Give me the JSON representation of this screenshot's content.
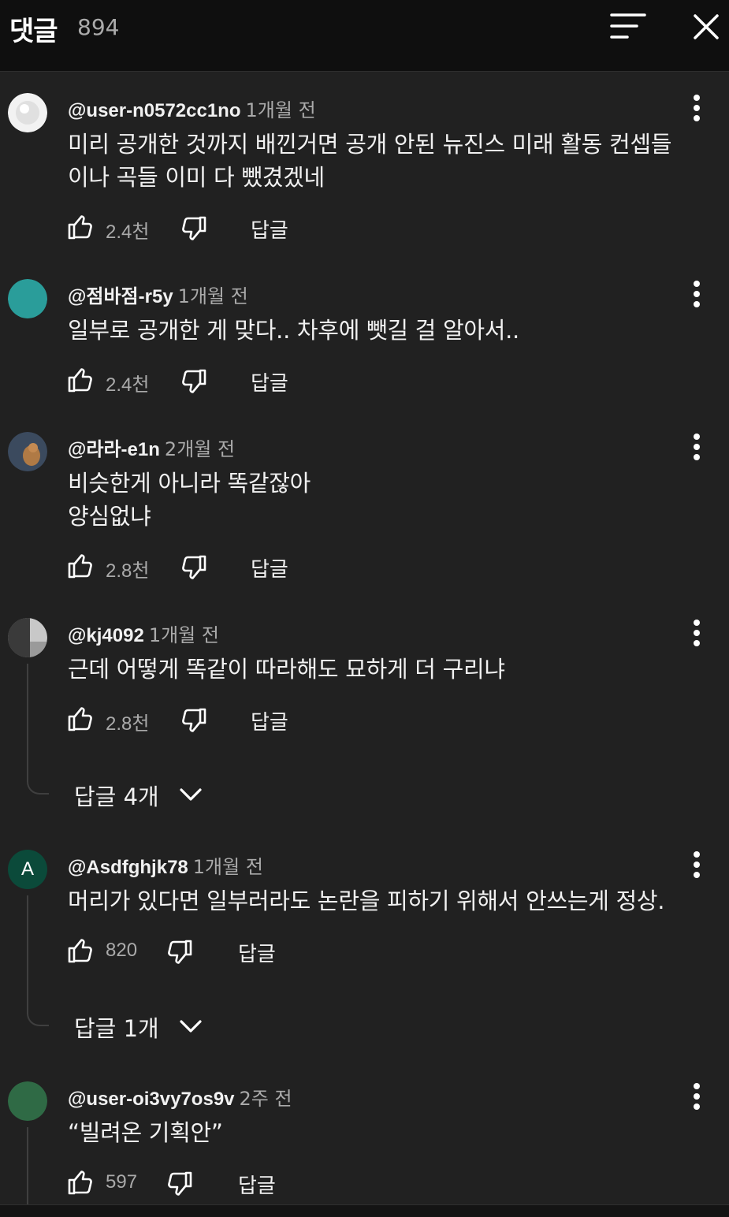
{
  "header": {
    "title": "댓글",
    "count": "894",
    "sort_icon": "sort-icon",
    "close_icon": "close-icon"
  },
  "comments": [
    {
      "author": "@user-n0572cc1no",
      "time": "1개월 전",
      "text_lines": [
        "미리 공개한 것까지 배낀거면 공개 안된 뉴진스 미래 활동 컨셉들",
        "이나 곡들 이미 다 뺐겼겠네"
      ],
      "likes": "2.4천",
      "reply_label": "답글",
      "avatar_color": "#e8e8e8"
    },
    {
      "author": "@점바점-r5y",
      "time": "1개월 전",
      "text_lines": [
        "일부로 공개한 게 맞다.. 차후에 뺏길 걸 알아서.."
      ],
      "likes": "2.4천",
      "reply_label": "답글",
      "avatar_color": "#2a9d9a"
    },
    {
      "author": "@라라-e1n",
      "time": "2개월 전",
      "text_lines": [
        "비슷한게 아니라 똑같잖아",
        "양심없냐"
      ],
      "likes": "2.8천",
      "reply_label": "답글",
      "avatar_color": "#3b4a5e"
    },
    {
      "author": "@kj4092",
      "time": "1개월 전",
      "text_lines": [
        "근데 어떻게 똑같이 따라해도 묘하게 더 구리냐"
      ],
      "likes": "2.8천",
      "reply_label": "답글",
      "avatar_color": "#8a8a8a",
      "replies_label": "답글 4개"
    },
    {
      "author": "@Asdfghjk78",
      "time": "1개월 전",
      "text_lines": [
        "머리가 있다면 일부러라도 논란을 피하기 위해서 안쓰는게 정상."
      ],
      "likes": "820",
      "reply_label": "답글",
      "avatar_letter": "A",
      "avatar_color": "#0b4a3a",
      "replies_label": "답글 1개"
    },
    {
      "author": "@user-oi3vy7os9v",
      "time": "2주 전",
      "text_lines": [
        "“빌려온 기획안”"
      ],
      "likes": "597",
      "reply_label": "답글",
      "avatar_color": "#2f6a45"
    }
  ],
  "icons": {
    "like": "thumb-up-icon",
    "dislike": "thumb-down-icon",
    "more": "more-vert-icon",
    "expand": "chevron-down-icon"
  }
}
